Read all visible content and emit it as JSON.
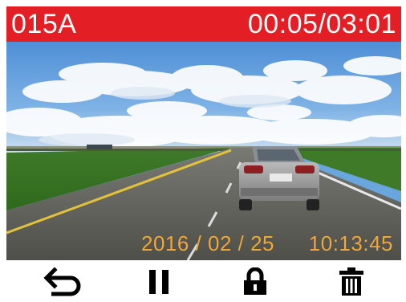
{
  "header": {
    "file_label": "015A",
    "time_position": "00:05/03:01"
  },
  "overlay": {
    "date": "2016 / 02 / 25",
    "time": "10:13:45"
  },
  "car_plate": "",
  "controls": {
    "items": [
      {
        "icon": "back-arrow-icon"
      },
      {
        "icon": "pause-icon"
      },
      {
        "icon": "lock-icon"
      },
      {
        "icon": "trash-icon"
      }
    ]
  },
  "colors": {
    "header_bg": "#e31e24",
    "header_text": "#ffffff",
    "overlay_text": "#f0a83b",
    "icon_color": "#000000"
  }
}
